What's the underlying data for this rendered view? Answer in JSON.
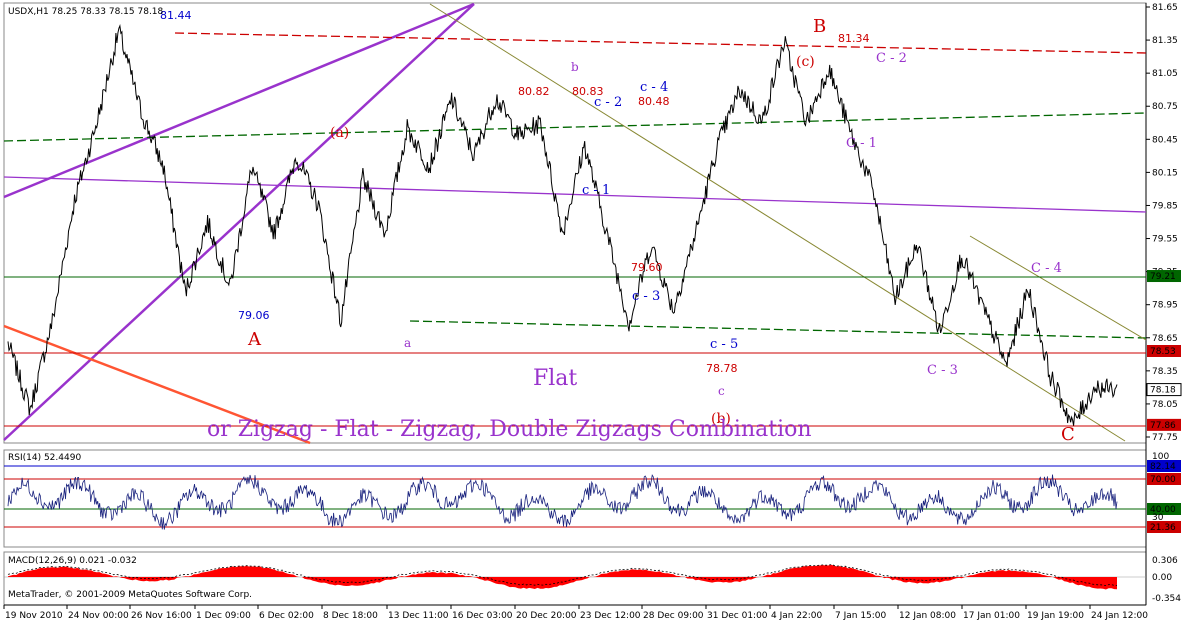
{
  "header": {
    "symbol_line": "USDX,H1  78.25 78.33 78.15 78.18",
    "rsi_line": "RSI(14) 52.4490",
    "macd_line": "MACD(12,26,9) 0.021 -0.032",
    "copyright": "MetaTrader, © 2001-2009 MetaQuotes Software Corp."
  },
  "colors": {
    "price": "#000000",
    "purple": "#9933cc",
    "red": "#cc0000",
    "green": "#006600",
    "blue": "#0000cc",
    "olive": "#888833",
    "salmon": "#ff5533"
  },
  "chart_data": [
    {
      "type": "line",
      "panel": "price",
      "ylim": [
        77.62,
        81.65
      ],
      "y_ticks": [
        "81.65",
        "81.35",
        "81.05",
        "80.75",
        "80.45",
        "80.15",
        "79.85",
        "79.55",
        "79.25",
        "78.95",
        "78.65",
        "78.35",
        "78.05",
        "77.75"
      ],
      "x_ticks": [
        "19 Nov 2010",
        "24 Nov 00:00",
        "26 Nov 16:00",
        "1 Dec 09:00",
        "6 Dec 02:00",
        "8 Dec 18:00",
        "13 Dec 11:00",
        "16 Dec 03:00",
        "20 Dec 20:00",
        "23 Dec 12:00",
        "28 Dec 09:00",
        "31 Dec 01:00",
        "4 Jan 22:00",
        "7 Jan 15:00",
        "12 Jan 08:00",
        "17 Jan 01:00",
        "19 Jan 19:00",
        "24 Jan 12:00"
      ],
      "price_path": [
        [
          0,
          78.6
        ],
        [
          1,
          78.0
        ],
        [
          2,
          78.8
        ],
        [
          3,
          79.9
        ],
        [
          4,
          80.6
        ],
        [
          5,
          81.44
        ],
        [
          6,
          80.7
        ],
        [
          7,
          80.2
        ],
        [
          8,
          79.06
        ],
        [
          9,
          79.7
        ],
        [
          10,
          79.1
        ],
        [
          11,
          80.2
        ],
        [
          12,
          79.6
        ],
        [
          13,
          80.3
        ],
        [
          14,
          79.85
        ],
        [
          15,
          78.8
        ],
        [
          16,
          80.1
        ],
        [
          17,
          79.6
        ],
        [
          18,
          80.55
        ],
        [
          19,
          80.2
        ],
        [
          20,
          80.82
        ],
        [
          21,
          80.3
        ],
        [
          22,
          80.83
        ],
        [
          23,
          80.48
        ],
        [
          24,
          80.6
        ],
        [
          25,
          79.6
        ],
        [
          26,
          80.4
        ],
        [
          27,
          79.6
        ],
        [
          28,
          78.78
        ],
        [
          29,
          79.5
        ],
        [
          30,
          78.9
        ],
        [
          31,
          79.6
        ],
        [
          32,
          80.4
        ],
        [
          33,
          80.9
        ],
        [
          34,
          80.6
        ],
        [
          35,
          81.34
        ],
        [
          36,
          80.6
        ],
        [
          37,
          81.1
        ],
        [
          38,
          80.5
        ],
        [
          39,
          80.0
        ],
        [
          40,
          79.0
        ],
        [
          41,
          79.5
        ],
        [
          42,
          78.7
        ],
        [
          43,
          79.4
        ],
        [
          44,
          78.9
        ],
        [
          45,
          78.4
        ],
        [
          46,
          79.1
        ],
        [
          47,
          78.3
        ],
        [
          48,
          77.86
        ],
        [
          49,
          78.2
        ],
        [
          50,
          78.18
        ]
      ],
      "last_price": "78.18",
      "price_labels": [
        {
          "text": "81.44",
          "color": "#0000cc"
        },
        {
          "text": "79.06",
          "color": "#0000cc"
        },
        {
          "text": "80.82",
          "color": "#cc0000"
        },
        {
          "text": "80.83",
          "color": "#cc0000"
        },
        {
          "text": "80.48",
          "color": "#cc0000"
        },
        {
          "text": "79.60",
          "color": "#cc0000"
        },
        {
          "text": "78.78",
          "color": "#cc0000"
        },
        {
          "text": "81.34",
          "color": "#cc0000"
        }
      ],
      "levels": [
        {
          "label": "79.21",
          "value": 79.21,
          "color": "#006600"
        },
        {
          "label": "78.53",
          "value": 78.53,
          "color": "#cc0000"
        },
        {
          "label": "77.86",
          "value": 77.86,
          "color": "#cc0000"
        }
      ],
      "wave_labels": [
        {
          "text": "A",
          "color": "#cc0000"
        },
        {
          "text": "B",
          "color": "#cc0000"
        },
        {
          "text": "C",
          "color": "#cc0000"
        },
        {
          "text": "(a)",
          "color": "#cc0000"
        },
        {
          "text": "(b)",
          "color": "#cc0000"
        },
        {
          "text": "(c)",
          "color": "#cc0000"
        },
        {
          "text": "a",
          "color": "#9933cc"
        },
        {
          "text": "b",
          "color": "#9933cc"
        },
        {
          "text": "c",
          "color": "#9933cc"
        },
        {
          "text": "c - 1",
          "color": "#0000cc"
        },
        {
          "text": "c - 2",
          "color": "#0000cc"
        },
        {
          "text": "c - 3",
          "color": "#0000cc"
        },
        {
          "text": "c - 4",
          "color": "#0000cc"
        },
        {
          "text": "c - 5",
          "color": "#0000cc"
        },
        {
          "text": "C - 1",
          "color": "#9933cc"
        },
        {
          "text": "C - 2",
          "color": "#9933cc"
        },
        {
          "text": "C - 3",
          "color": "#9933cc"
        },
        {
          "text": "C - 4",
          "color": "#9933cc"
        }
      ],
      "annotations": {
        "flat": "Flat",
        "combo": "or Zigzag - Flat - Zigzag, Double Zigzags Combination"
      }
    },
    {
      "type": "line",
      "panel": "rsi",
      "ylim": [
        0,
        100
      ],
      "y_ticks": [
        "100",
        "82.14",
        "70.00",
        "40.00",
        "30",
        "21.36"
      ]
    },
    {
      "type": "area",
      "panel": "macd",
      "y_ticks": [
        "0.306",
        "0.00",
        "-0.354"
      ]
    }
  ]
}
